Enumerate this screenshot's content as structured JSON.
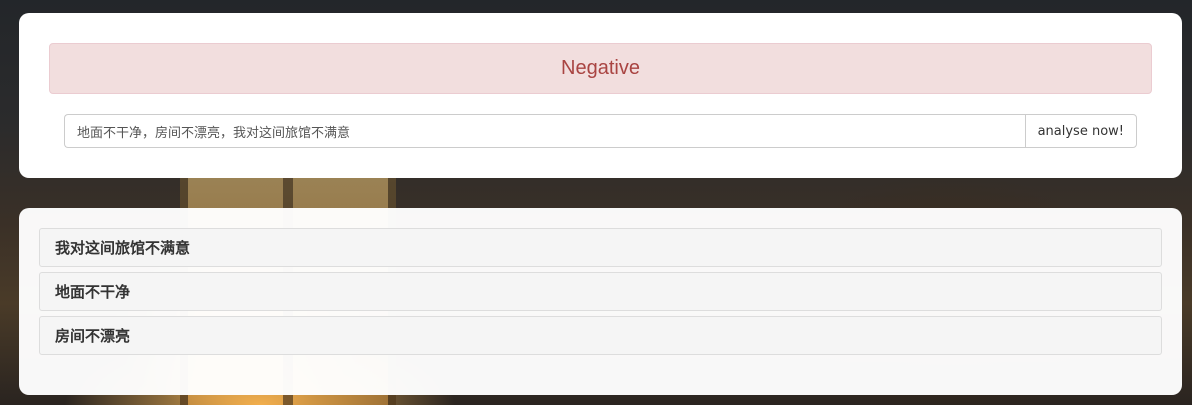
{
  "analysis": {
    "result_label": "Negative",
    "input_value": "地面不干净，房间不漂亮，我对这间旅馆不满意",
    "button_label": "analyse now!"
  },
  "sentences": [
    {
      "text": "我对这间旅馆不满意"
    },
    {
      "text": "地面不干净"
    },
    {
      "text": "房间不漂亮"
    }
  ],
  "colors": {
    "alert_background": "#f2dede",
    "alert_text": "#a94442",
    "alert_border": "#ebccd1"
  }
}
